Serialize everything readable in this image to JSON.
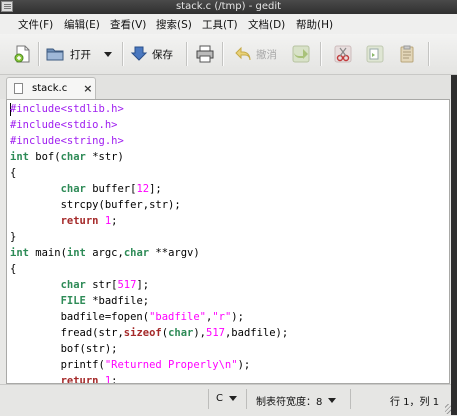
{
  "window": {
    "title": "stack.c (/tmp) - gedit"
  },
  "menu": [
    "文件(F)",
    "编辑(E)",
    "查看(V)",
    "搜索(S)",
    "工具(T)",
    "文档(D)",
    "帮助(H)"
  ],
  "toolbar": {
    "open_label": "打开",
    "save_label": "保存",
    "undo_label": "撤消"
  },
  "tab": {
    "filename": "stack.c",
    "close": "×"
  },
  "code": {
    "lines": [
      "#include<stdlib.h>",
      "#include<stdio.h>",
      "#include<string.h>",
      "int bof(char *str)",
      "{",
      "        char buffer[12];",
      "        strcpy(buffer,str);",
      "        return 1;",
      "}",
      "int main(int argc,char **argv)",
      "{",
      "        char str[517];",
      "        FILE *badfile;",
      "        badfile=fopen(\"badfile\",\"r\");",
      "        fread(str,sizeof(char),517,badfile);",
      "        bof(str);",
      "        printf(\"Returned Properly\\n\");",
      "        return 1;"
    ]
  },
  "status": {
    "language": "C",
    "tab_width": "制表符宽度：8",
    "position": "行 1，列 1"
  },
  "colors": {
    "preprocessor": "#a020f0",
    "type": "#2e8b57",
    "keyword": "#a52a2a",
    "literal": "#ff00ff"
  }
}
